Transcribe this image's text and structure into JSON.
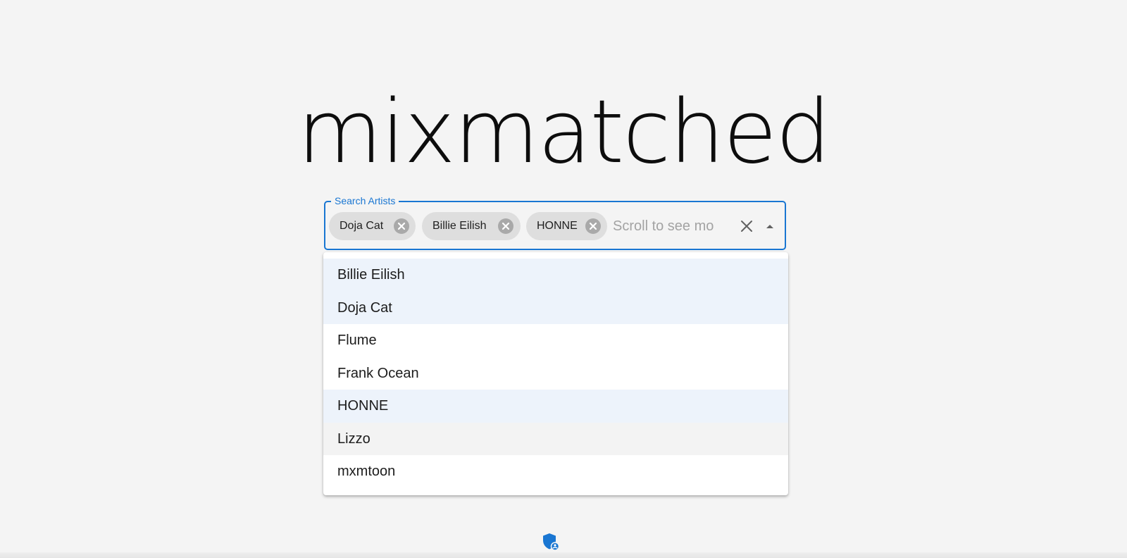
{
  "app": {
    "title": "mixmatched"
  },
  "search": {
    "label": "Search Artists",
    "placeholder": "Scroll to see mo",
    "chips": [
      {
        "label": "Doja Cat"
      },
      {
        "label": "Billie Eilish"
      },
      {
        "label": "HONNE"
      }
    ]
  },
  "options": [
    {
      "label": "Billie Eilish",
      "selected": true
    },
    {
      "label": "Doja Cat",
      "selected": true
    },
    {
      "label": "Flume",
      "selected": false
    },
    {
      "label": "Frank Ocean",
      "selected": false
    },
    {
      "label": "HONNE",
      "selected": true
    },
    {
      "label": "Lizzo",
      "selected": false,
      "hovered": true
    },
    {
      "label": "mxmtoon",
      "selected": false
    }
  ],
  "colors": {
    "accent": "#1976d2",
    "background": "#f4f4f4",
    "selected_option": "#edf3fb",
    "chip": "#dedede"
  },
  "icons": {
    "chip_delete": "cancel-icon",
    "clear": "close-icon",
    "popup": "arrow-drop-up-icon",
    "footer": "shield-icon"
  }
}
